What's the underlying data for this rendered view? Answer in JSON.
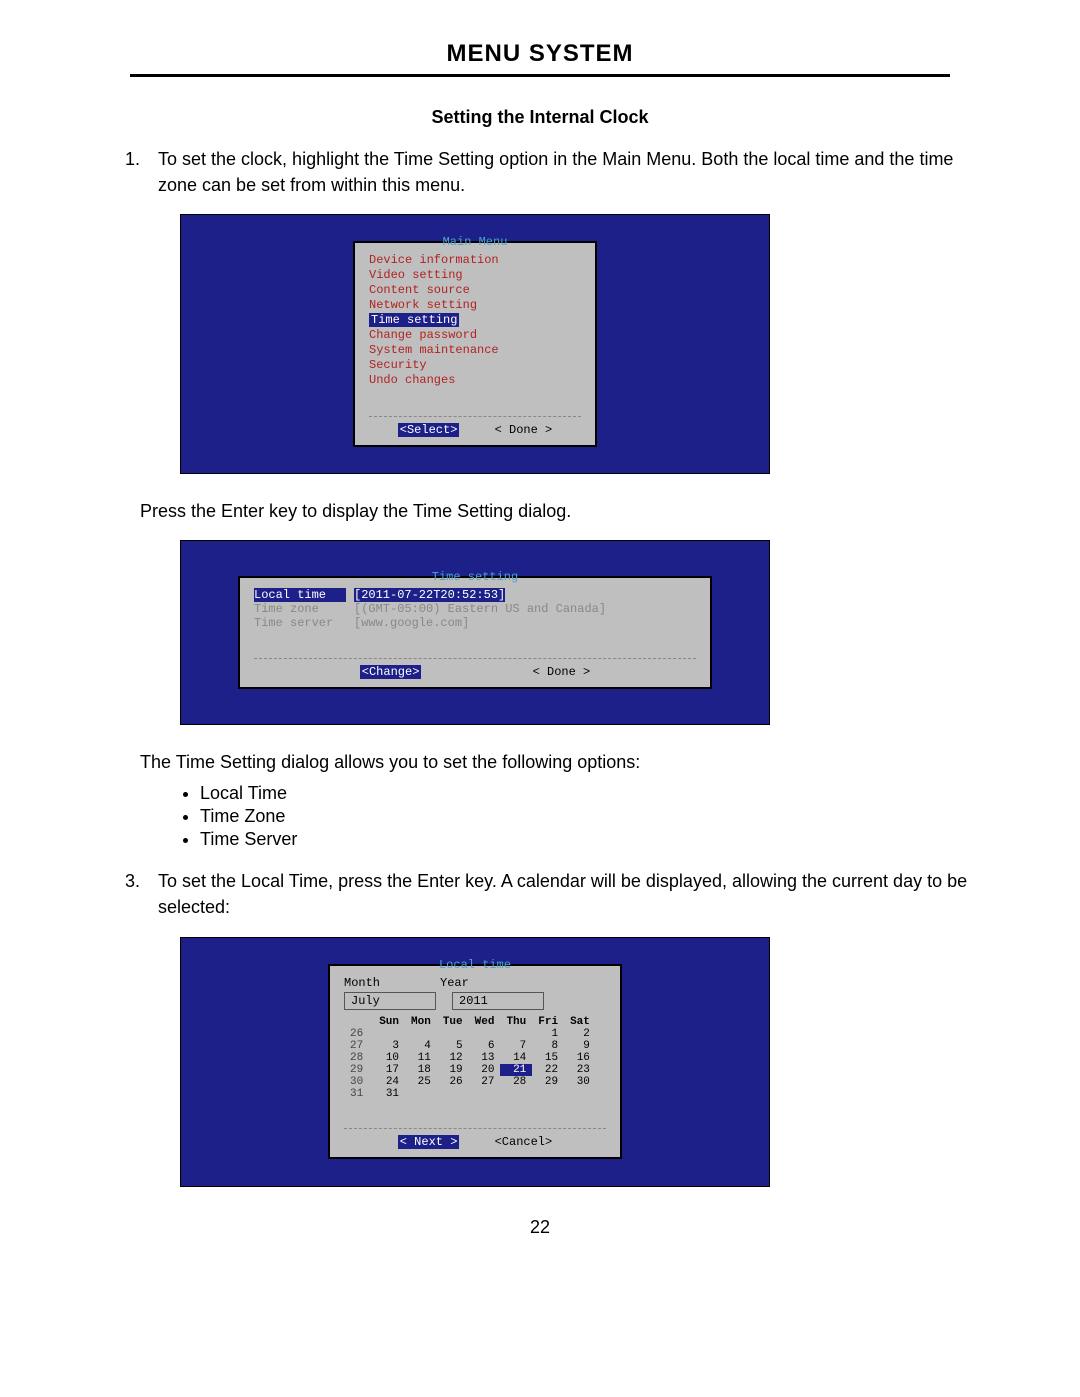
{
  "header": "MENU SYSTEM",
  "section_title": "Setting the Internal Clock",
  "step1_num": "1.",
  "step1_text": "To set the clock, highlight the Time Setting option in the Main Menu.  Both the local time and the time zone can be set from within this menu.",
  "after_shot1": "Press the Enter key to display the Time Setting dialog.",
  "after_shot2": "The Time Setting dialog allows you to set the following options:",
  "options": [
    "Local Time",
    "Time Zone",
    "Time Server"
  ],
  "step3_num": "3.",
  "step3_text": "To set the Local Time, press the Enter key.  A calendar will be displayed, allowing the current day to be selected:",
  "page_number": "22",
  "main_menu": {
    "title": "Main Menu",
    "items": [
      "Device information",
      "Video setting",
      "Content source",
      "Network setting",
      "Time setting",
      "Change password",
      "System maintenance",
      "Security",
      "Undo changes"
    ],
    "selected_index": 4,
    "btn_select": "<Select>",
    "btn_done": "< Done >"
  },
  "time_setting": {
    "title": "Time setting",
    "rows": [
      {
        "k": "Local time",
        "v": "[2011-07-22T20:52:53]",
        "ksel": true,
        "vsel": true
      },
      {
        "k": "Time zone",
        "v": "[(GMT-05:00) Eastern US and Canada]",
        "dim": true
      },
      {
        "k": "Time server",
        "v": "[www.google.com]",
        "dim": true
      }
    ],
    "btn_change": "<Change>",
    "btn_done": "< Done >"
  },
  "local_time": {
    "title": "Local time",
    "month_label": "Month",
    "year_label": "Year",
    "month": "July",
    "year": "2011",
    "dow": [
      "Sun",
      "Mon",
      "Tue",
      "Wed",
      "Thu",
      "Fri",
      "Sat"
    ],
    "weeks": [
      {
        "wk": "26",
        "d": [
          "",
          "",
          "",
          "",
          "",
          "1",
          "2"
        ]
      },
      {
        "wk": "27",
        "d": [
          "3",
          "4",
          "5",
          "6",
          "7",
          "8",
          "9"
        ]
      },
      {
        "wk": "28",
        "d": [
          "10",
          "11",
          "12",
          "13",
          "14",
          "15",
          "16"
        ]
      },
      {
        "wk": "29",
        "d": [
          "17",
          "18",
          "19",
          "20",
          "21",
          "22",
          "23"
        ]
      },
      {
        "wk": "30",
        "d": [
          "24",
          "25",
          "26",
          "27",
          "28",
          "29",
          "30"
        ]
      },
      {
        "wk": "31",
        "d": [
          "31",
          "",
          "",
          "",
          "",
          "",
          ""
        ]
      }
    ],
    "today": "21",
    "btn_next": "< Next >",
    "btn_cancel": "<Cancel>"
  }
}
